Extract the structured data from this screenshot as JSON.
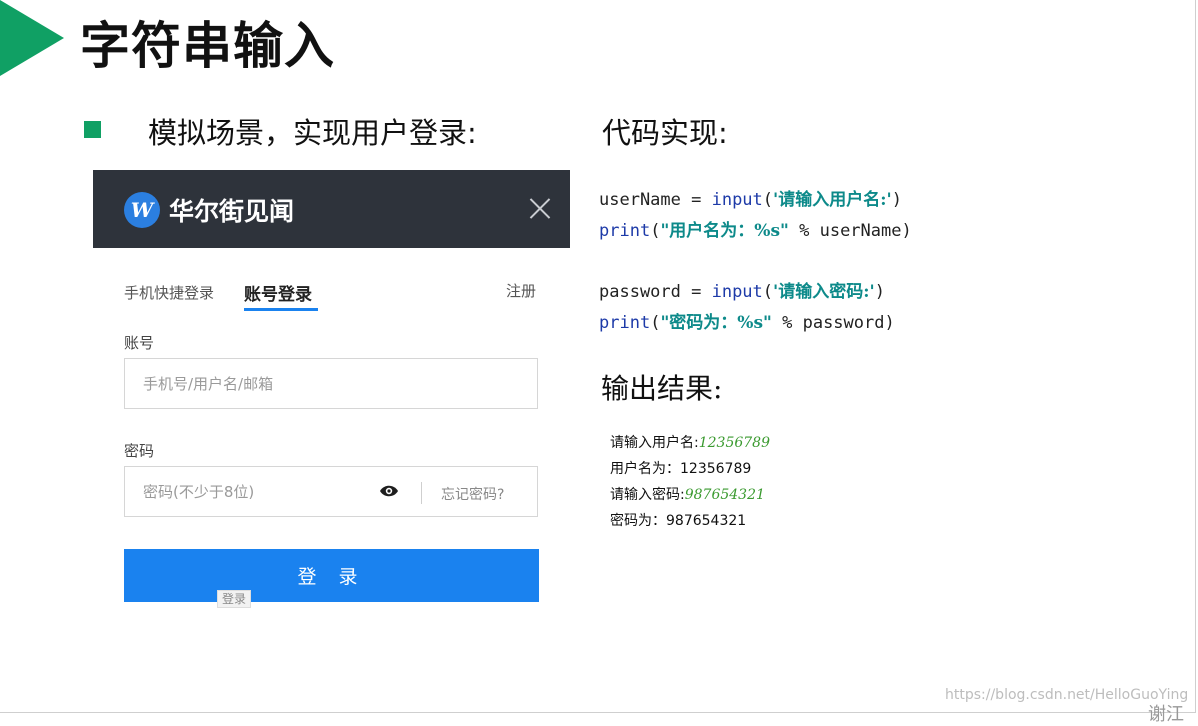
{
  "slide": {
    "title": "字符串输入",
    "bullet": "模拟场景，实现用户登录:",
    "code_heading": "代码实现:",
    "output_heading": "输出结果:",
    "watermark": "https://blog.csdn.net/HelloGuoYing",
    "corner_text": "谢江"
  },
  "colors": {
    "accent_green": "#10a064",
    "login_header_bg": "#2e333b",
    "login_blue": "#1a82ef"
  },
  "login": {
    "brand_logo_letter": "W",
    "brand_name": "华尔街见闻",
    "close_icon": "close-icon",
    "tab_quick": "手机快捷登录",
    "tab_account": "账号登录",
    "register": "注册",
    "account_label": "账号",
    "account_placeholder": "手机号/用户名/邮箱",
    "password_label": "密码",
    "password_placeholder": "密码(不少于8位)",
    "eye_icon": "eye-icon",
    "forgot": "忘记密码?",
    "submit": "登 录",
    "tooltip": "登录"
  },
  "code": {
    "line1": {
      "var": "userName = ",
      "func": "input",
      "open": "(",
      "str": "'请输入用户名:'",
      "close": ")"
    },
    "line2": {
      "func": "print",
      "open": "(",
      "str": "\"用户名为：%s\"",
      "rest": " % userName)"
    },
    "line3": {
      "var": "password = ",
      "func": "input",
      "open": "(",
      "str": "'请输入密码:'",
      "close": ")"
    },
    "line4": {
      "func": "print",
      "open": "(",
      "str": "\"密码为：%s\"",
      "rest": " % password)"
    }
  },
  "output": {
    "line1_label": "请输入用户名:",
    "line1_value": "12356789",
    "line2": "用户名为：12356789",
    "line3_label": "请输入密码:",
    "line3_value": "987654321",
    "line4": "密码为：987654321"
  }
}
